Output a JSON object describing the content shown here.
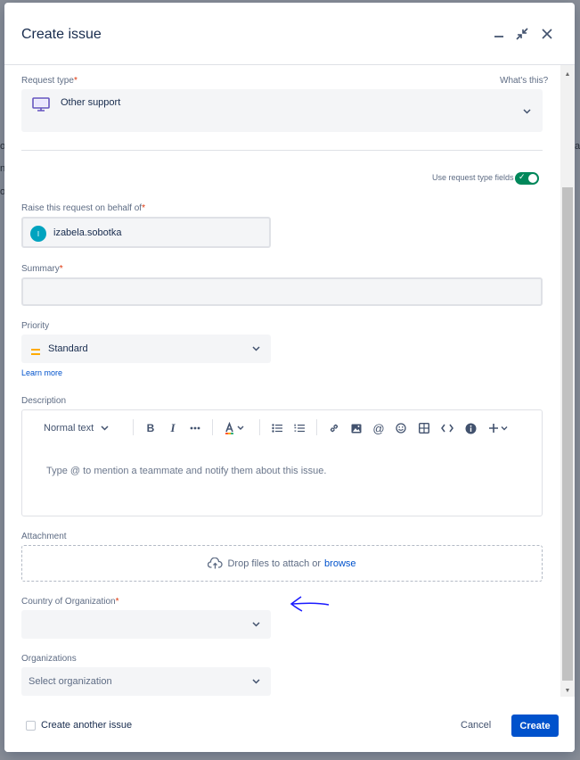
{
  "background": {
    "left_fragments": [
      "o",
      "n",
      "o"
    ],
    "right_fragments": [
      "a"
    ]
  },
  "dialog": {
    "title": "Create issue",
    "icons": [
      "minimize-icon",
      "collapse-icon",
      "close-icon"
    ]
  },
  "request_type": {
    "label": "Request type",
    "required": "*",
    "help_link": "What's this?",
    "value": "Other support",
    "icon": "monitor-icon"
  },
  "request_type_fields": {
    "label": "Use request type fields",
    "enabled": true
  },
  "on_behalf": {
    "label": "Raise this request on behalf of",
    "required": "*",
    "value": "izabela.sobotka",
    "avatar_letter": "I"
  },
  "summary": {
    "label": "Summary",
    "required": "*",
    "value": ""
  },
  "priority": {
    "label": "Priority",
    "value": "Standard",
    "learn_more": "Learn more",
    "icon_color": "#ffab00"
  },
  "description": {
    "label": "Description",
    "text_style": "Normal text",
    "placeholder": "Type @ to mention a teammate and notify them about this issue."
  },
  "attachment": {
    "label": "Attachment",
    "drop_text": "Drop files to attach or",
    "browse_text": "browse"
  },
  "country": {
    "label": "Country of Organization",
    "required": "*",
    "value": ""
  },
  "organizations": {
    "label": "Organizations",
    "placeholder": "Select organization"
  },
  "footer": {
    "create_another_label": "Create another issue",
    "cancel_label": "Cancel",
    "create_label": "Create"
  },
  "colors": {
    "primary": "#0052cc",
    "toggle_on": "#00875a",
    "annotation_arrow": "#1a1aff",
    "required": "#de350b"
  }
}
